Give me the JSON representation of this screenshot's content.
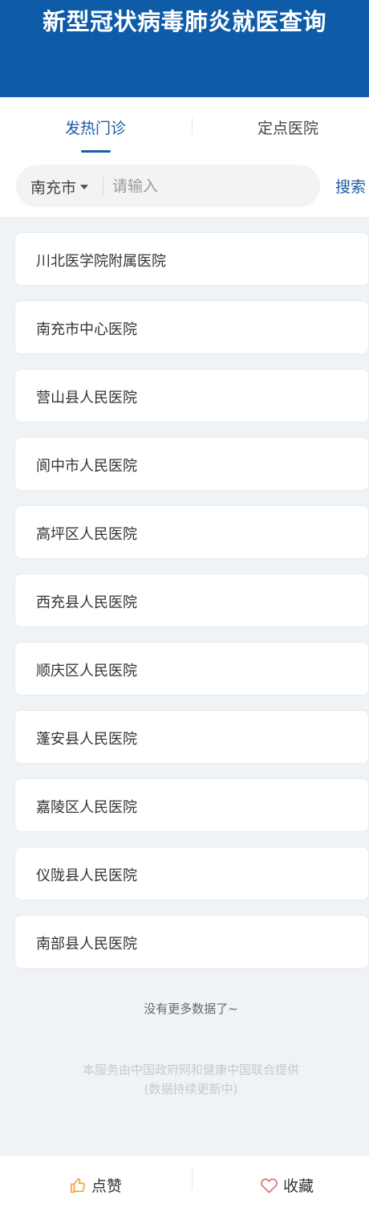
{
  "header": {
    "title": "新型冠状病毒肺炎就医查询"
  },
  "tabs": [
    {
      "label": "发热门诊",
      "active": true
    },
    {
      "label": "定点医院",
      "active": false
    }
  ],
  "search": {
    "city": "南充市",
    "placeholder": "请输入",
    "value": "",
    "button_label": "搜索"
  },
  "hospitals": [
    "川北医学院附属医院",
    "南充市中心医院",
    "营山县人民医院",
    "阆中市人民医院",
    "高坪区人民医院",
    "西充县人民医院",
    "顺庆区人民医院",
    "蓬安县人民医院",
    "嘉陵区人民医院",
    "仪陇县人民医院",
    "南部县人民医院"
  ],
  "footer": {
    "no_more": "没有更多数据了~",
    "service_line1": "本服务由中国政府网和健康中国联合提供",
    "service_line2": "(数据持续更新中)"
  },
  "bottom_bar": {
    "like_label": "点赞",
    "favorite_label": "收藏"
  },
  "colors": {
    "header_bg": "#0e5ba8",
    "accent": "#1a5ea8",
    "like_icon": "#f2a23a",
    "favorite_icon": "#e07a7a"
  },
  "icons": {
    "city_dropdown": "caret-down-icon",
    "like": "thumbs-up-icon",
    "favorite": "heart-icon"
  }
}
